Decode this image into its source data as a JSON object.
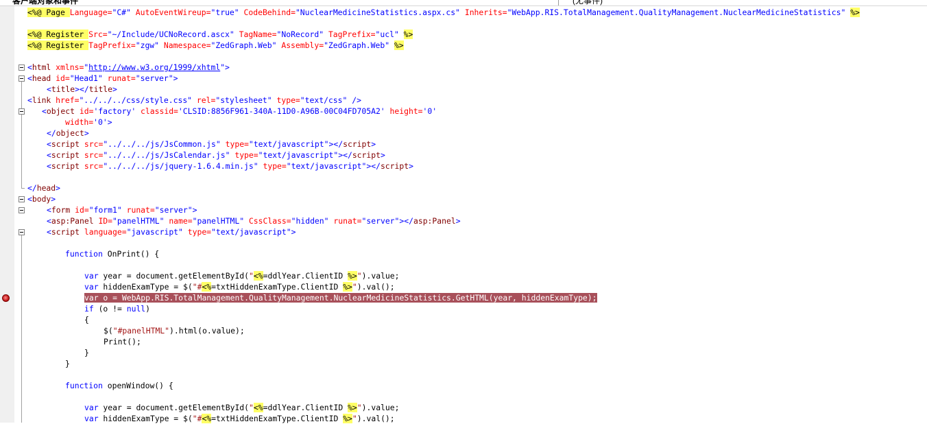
{
  "window": {
    "tab_left": "客户端对象和事件",
    "tab_right": "(无事件)"
  },
  "code_lines": {
    "l1": {
      "a": "<%@ Page ",
      "b": "Language=",
      "c": "\"C#\" ",
      "d": "AutoEventWireup=",
      "e": "\"true\" ",
      "f": "CodeBehind=",
      "g": "\"NuclearMedicineStatistics.aspx.cs\" ",
      "h": "Inherits=",
      "i": "\"WebApp.RIS.TotalManagement.QualityManagement.NuclearMedicineStatistics\" ",
      "j": "%>"
    },
    "l3": {
      "a": "<%@ Register ",
      "b": "Src=",
      "c": "\"~/Include/UCNoRecord.ascx\" ",
      "d": "TagName=",
      "e": "\"NoRecord\" ",
      "f": "TagPrefix=",
      "g": "\"ucl\" ",
      "h": "%>"
    },
    "l4": {
      "a": "<%@ Register ",
      "b": "TagPrefix=",
      "c": "\"zgw\" ",
      "d": "Namespace=",
      "e": "\"ZedGraph.Web\" ",
      "f": "Assembly=",
      "g": "\"ZedGraph.Web\" ",
      "h": "%>"
    },
    "l6": {
      "a": "<",
      "b": "html",
      "c": " xmlns=",
      "d": "\"",
      "e": "http://www.w3.org/1999/xhtml",
      "f": "\">"
    },
    "l7": {
      "a": "<",
      "b": "head",
      "c": " id=",
      "d": "\"Head1\"",
      "e": " runat=",
      "f": "\"server\"",
      "g": ">"
    },
    "l8": {
      "a": "<",
      "b": "title",
      "c": "></",
      "d": "title",
      "e": ">"
    },
    "l9": {
      "a": "<",
      "b": "link",
      "c": " href=",
      "d": "\"../../../css/style.css\"",
      "e": " rel=",
      "f": "\"stylesheet\"",
      "g": " type=",
      "h": "\"text/css\"",
      "i": " />"
    },
    "l10": {
      "a": "<",
      "b": "object",
      "c": " id=",
      "d": "'factory'",
      "e": " classid=",
      "f": "'CLSID:8856F961-340A-11D0-A96B-00C04FD705A2'",
      "g": " height=",
      "h": "'0'"
    },
    "l11": {
      "a": "width=",
      "b": "'0'",
      "c": ">"
    },
    "l12": {
      "a": "</",
      "b": "object",
      "c": ">"
    },
    "l13": {
      "a": "<",
      "b": "script",
      "c": " src=",
      "d": "\"../../../js/JsCommon.js\"",
      "e": " type=",
      "f": "\"text/javascript\"",
      "g": "></",
      "h": "script",
      "i": ">"
    },
    "l14": {
      "a": "<",
      "b": "script",
      "c": " src=",
      "d": "\"../../../js/JsCalendar.js\"",
      "e": " type=",
      "f": "\"text/javascript\"",
      "g": "></",
      "h": "script",
      "i": ">"
    },
    "l15": {
      "a": "<",
      "b": "script",
      "c": " src=",
      "d": "\"../../../js/jquery-1.6.4.min.js\"",
      "e": " type=",
      "f": "\"text/javascript\"",
      "g": "></",
      "h": "script",
      "i": ">"
    },
    "l17": {
      "a": "</",
      "b": "head",
      "c": ">"
    },
    "l18": {
      "a": "<",
      "b": "body",
      "c": ">"
    },
    "l19": {
      "a": "<",
      "b": "form",
      "c": " id=",
      "d": "\"form1\"",
      "e": " runat=",
      "f": "\"server\"",
      "g": ">"
    },
    "l20": {
      "a": "<",
      "b": "asp:Panel",
      "c": " ID=",
      "d": "\"panelHTML\"",
      "e": " name=",
      "f": "\"panelHTML\"",
      "g": " CssClass=",
      "h": "\"hidden\"",
      "i": " runat=",
      "j": "\"server\"",
      "k": "></",
      "l": "asp:Panel",
      "m": ">"
    },
    "l21": {
      "a": "<",
      "b": "script",
      "c": " language=",
      "d": "\"javascript\"",
      "e": " type=",
      "f": "\"text/javascript\"",
      "g": ">"
    },
    "l23": {
      "a": "function",
      "b": " OnPrint() {"
    },
    "l25": {
      "a": "var",
      "b": " year = document.getElementById(",
      "c": "\"",
      "d": "<%",
      "e": "=ddlYear.ClientID ",
      "f": "%>",
      "g": "\"",
      "h": ").value;"
    },
    "l26": {
      "a": "var",
      "b": " hiddenExamType = $(",
      "c": "\"#",
      "d": "<%",
      "e": "=txtHiddenExamType.ClientID ",
      "f": "%>",
      "g": "\"",
      "h": ").val();"
    },
    "l27": {
      "a": "var o = WebApp.RIS.TotalManagement.QualityManagement.NuclearMedicineStatistics.GetHTML(year, hiddenExamType);"
    },
    "l28": {
      "a": "if",
      "b": " (o != ",
      "c": "null",
      "d": ")"
    },
    "l29": {
      "a": "{"
    },
    "l30": {
      "a": "$(",
      "b": "\"#panelHTML\"",
      "c": ").html(o.value);"
    },
    "l31": {
      "a": "Print();"
    },
    "l32": {
      "a": "}"
    },
    "l33": {
      "a": "}"
    },
    "l35": {
      "a": "function",
      "b": " openWindow() {"
    },
    "l37": {
      "a": "var",
      "b": " year = document.getElementById(",
      "c": "\"",
      "d": "<%",
      "e": "=ddlYear.ClientID ",
      "f": "%>",
      "g": "\"",
      "h": ").value;"
    },
    "l38": {
      "a": "var",
      "b": " hiddenExamType = $(",
      "c": "\"#",
      "d": "<%",
      "e": "=txtHiddenExamType.ClientID ",
      "f": "%>",
      "g": "\"",
      "h": ").val();"
    }
  }
}
